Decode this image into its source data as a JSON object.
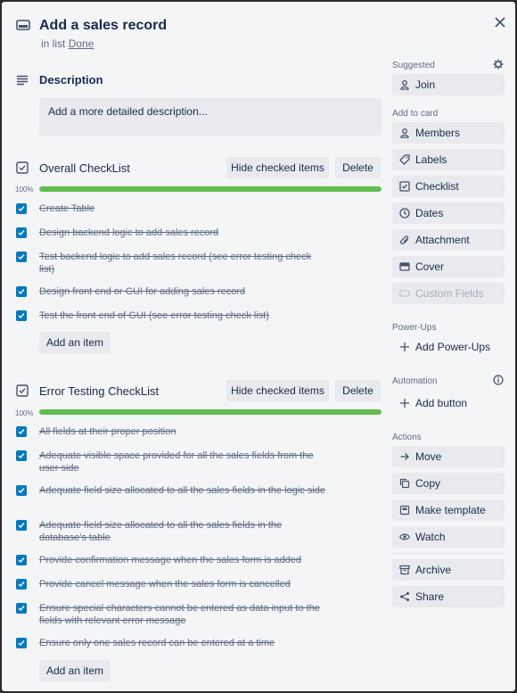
{
  "card": {
    "title": "Add a sales record",
    "in_list_prefix": "in list",
    "list_name": "Done"
  },
  "description": {
    "heading": "Description",
    "placeholder": "Add a more detailed description..."
  },
  "checklists": [
    {
      "title": "Overall CheckList",
      "hide_label": "Hide checked items",
      "delete_label": "Delete",
      "progress_text": "100%",
      "progress": 1.0,
      "items": [
        "Create Table",
        "Design backend logic to add sales record",
        "Test backend logic to add sales record (see error testing check list)",
        "Design front end or GUI for adding sales record",
        "Test the front end of GUI (see error testing check list)"
      ],
      "add_label": "Add an item"
    },
    {
      "title": "Error Testing CheckList",
      "hide_label": "Hide checked items",
      "delete_label": "Delete",
      "progress_text": "100%",
      "progress": 1.0,
      "items": [
        "All fields at their proper position",
        "Adequate visible space provided for all the sales fields from the user side",
        "Adequate field size allocated to all the sales fields in the logic side",
        "Adequate field size allocated to all the sales fields in the database's table",
        "Provide confirmation message when the sales form is added",
        "Provide cancel message when the sales form is cancelled",
        "Ensure special characters cannot be entered as data input to the fields with relevant error message",
        "Ensure only one sales record can be entered at a time"
      ],
      "add_label": "Add an item"
    }
  ],
  "sidebar": {
    "suggested_label": "Suggested",
    "join": "Join",
    "add_to_card_label": "Add to card",
    "members": "Members",
    "labels": "Labels",
    "checklist": "Checklist",
    "dates": "Dates",
    "attachment": "Attachment",
    "cover": "Cover",
    "custom_fields": "Custom Fields",
    "powerups_label": "Power-Ups",
    "add_powerups": "Add Power-Ups",
    "automation_label": "Automation",
    "add_button": "Add button",
    "actions_label": "Actions",
    "move": "Move",
    "copy": "Copy",
    "make_template": "Make template",
    "watch": "Watch",
    "archive": "Archive",
    "share": "Share"
  },
  "colors": {
    "accent": "#0079bf",
    "progress": "#61bd4f",
    "panel": "#f4f5f7"
  }
}
